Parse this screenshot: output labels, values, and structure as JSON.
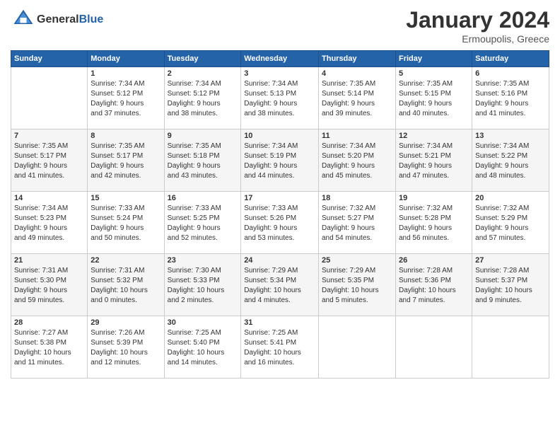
{
  "header": {
    "logo_general": "General",
    "logo_blue": "Blue",
    "month_title": "January 2024",
    "location": "Ermoupolis, Greece"
  },
  "days_of_week": [
    "Sunday",
    "Monday",
    "Tuesday",
    "Wednesday",
    "Thursday",
    "Friday",
    "Saturday"
  ],
  "weeks": [
    [
      {
        "day": "",
        "info": ""
      },
      {
        "day": "1",
        "info": "Sunrise: 7:34 AM\nSunset: 5:12 PM\nDaylight: 9 hours\nand 37 minutes."
      },
      {
        "day": "2",
        "info": "Sunrise: 7:34 AM\nSunset: 5:12 PM\nDaylight: 9 hours\nand 38 minutes."
      },
      {
        "day": "3",
        "info": "Sunrise: 7:34 AM\nSunset: 5:13 PM\nDaylight: 9 hours\nand 38 minutes."
      },
      {
        "day": "4",
        "info": "Sunrise: 7:35 AM\nSunset: 5:14 PM\nDaylight: 9 hours\nand 39 minutes."
      },
      {
        "day": "5",
        "info": "Sunrise: 7:35 AM\nSunset: 5:15 PM\nDaylight: 9 hours\nand 40 minutes."
      },
      {
        "day": "6",
        "info": "Sunrise: 7:35 AM\nSunset: 5:16 PM\nDaylight: 9 hours\nand 41 minutes."
      }
    ],
    [
      {
        "day": "7",
        "info": "Sunrise: 7:35 AM\nSunset: 5:17 PM\nDaylight: 9 hours\nand 41 minutes."
      },
      {
        "day": "8",
        "info": "Sunrise: 7:35 AM\nSunset: 5:17 PM\nDaylight: 9 hours\nand 42 minutes."
      },
      {
        "day": "9",
        "info": "Sunrise: 7:35 AM\nSunset: 5:18 PM\nDaylight: 9 hours\nand 43 minutes."
      },
      {
        "day": "10",
        "info": "Sunrise: 7:34 AM\nSunset: 5:19 PM\nDaylight: 9 hours\nand 44 minutes."
      },
      {
        "day": "11",
        "info": "Sunrise: 7:34 AM\nSunset: 5:20 PM\nDaylight: 9 hours\nand 45 minutes."
      },
      {
        "day": "12",
        "info": "Sunrise: 7:34 AM\nSunset: 5:21 PM\nDaylight: 9 hours\nand 47 minutes."
      },
      {
        "day": "13",
        "info": "Sunrise: 7:34 AM\nSunset: 5:22 PM\nDaylight: 9 hours\nand 48 minutes."
      }
    ],
    [
      {
        "day": "14",
        "info": "Sunrise: 7:34 AM\nSunset: 5:23 PM\nDaylight: 9 hours\nand 49 minutes."
      },
      {
        "day": "15",
        "info": "Sunrise: 7:33 AM\nSunset: 5:24 PM\nDaylight: 9 hours\nand 50 minutes."
      },
      {
        "day": "16",
        "info": "Sunrise: 7:33 AM\nSunset: 5:25 PM\nDaylight: 9 hours\nand 52 minutes."
      },
      {
        "day": "17",
        "info": "Sunrise: 7:33 AM\nSunset: 5:26 PM\nDaylight: 9 hours\nand 53 minutes."
      },
      {
        "day": "18",
        "info": "Sunrise: 7:32 AM\nSunset: 5:27 PM\nDaylight: 9 hours\nand 54 minutes."
      },
      {
        "day": "19",
        "info": "Sunrise: 7:32 AM\nSunset: 5:28 PM\nDaylight: 9 hours\nand 56 minutes."
      },
      {
        "day": "20",
        "info": "Sunrise: 7:32 AM\nSunset: 5:29 PM\nDaylight: 9 hours\nand 57 minutes."
      }
    ],
    [
      {
        "day": "21",
        "info": "Sunrise: 7:31 AM\nSunset: 5:30 PM\nDaylight: 9 hours\nand 59 minutes."
      },
      {
        "day": "22",
        "info": "Sunrise: 7:31 AM\nSunset: 5:32 PM\nDaylight: 10 hours\nand 0 minutes."
      },
      {
        "day": "23",
        "info": "Sunrise: 7:30 AM\nSunset: 5:33 PM\nDaylight: 10 hours\nand 2 minutes."
      },
      {
        "day": "24",
        "info": "Sunrise: 7:29 AM\nSunset: 5:34 PM\nDaylight: 10 hours\nand 4 minutes."
      },
      {
        "day": "25",
        "info": "Sunrise: 7:29 AM\nSunset: 5:35 PM\nDaylight: 10 hours\nand 5 minutes."
      },
      {
        "day": "26",
        "info": "Sunrise: 7:28 AM\nSunset: 5:36 PM\nDaylight: 10 hours\nand 7 minutes."
      },
      {
        "day": "27",
        "info": "Sunrise: 7:28 AM\nSunset: 5:37 PM\nDaylight: 10 hours\nand 9 minutes."
      }
    ],
    [
      {
        "day": "28",
        "info": "Sunrise: 7:27 AM\nSunset: 5:38 PM\nDaylight: 10 hours\nand 11 minutes."
      },
      {
        "day": "29",
        "info": "Sunrise: 7:26 AM\nSunset: 5:39 PM\nDaylight: 10 hours\nand 12 minutes."
      },
      {
        "day": "30",
        "info": "Sunrise: 7:25 AM\nSunset: 5:40 PM\nDaylight: 10 hours\nand 14 minutes."
      },
      {
        "day": "31",
        "info": "Sunrise: 7:25 AM\nSunset: 5:41 PM\nDaylight: 10 hours\nand 16 minutes."
      },
      {
        "day": "",
        "info": ""
      },
      {
        "day": "",
        "info": ""
      },
      {
        "day": "",
        "info": ""
      }
    ]
  ]
}
